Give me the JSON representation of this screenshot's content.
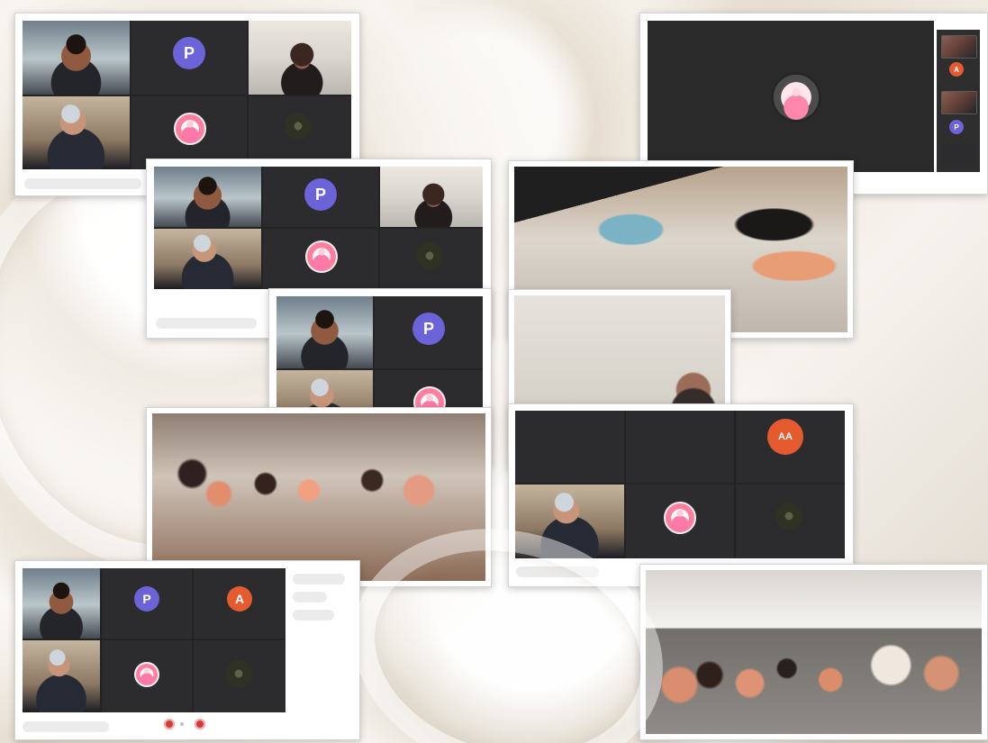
{
  "collage": {
    "avatars": {
      "p": "P",
      "a": "A",
      "aa": "AA"
    },
    "colors": {
      "avatar_purple": "#6c63d9",
      "avatar_orange": "#e35b2f",
      "control_red": "#d33b3b"
    }
  }
}
